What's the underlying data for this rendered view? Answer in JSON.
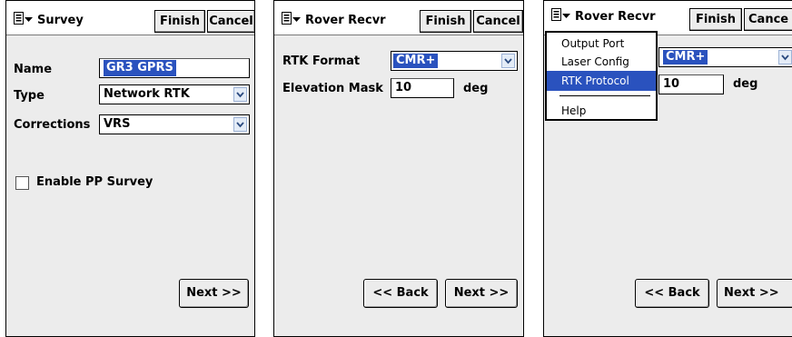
{
  "panel1": {
    "title": "Survey",
    "finish": "Finish",
    "cancel": "Cancel",
    "name_label": "Name",
    "name_value": "GR3 GPRS",
    "type_label": "Type",
    "type_value": "Network RTK",
    "corrections_label": "Corrections",
    "corrections_value": "VRS",
    "enable_pp_label": "Enable PP Survey",
    "enable_pp_checked": false,
    "next": "Next >>"
  },
  "panel2": {
    "title": "Rover Recvr",
    "finish": "Finish",
    "cancel": "Cancel",
    "rtk_format_label": "RTK Format",
    "rtk_format_value": "CMR+",
    "elevation_mask_label": "Elevation Mask",
    "elevation_mask_value": "10",
    "elevation_unit": "deg",
    "back": "<< Back",
    "next": "Next >>"
  },
  "panel3": {
    "title": "Rover Recvr",
    "finish": "Finish",
    "cancel": "Cance",
    "rtk_format_value": "CMR+",
    "elevation_mask_value": "10",
    "elevation_unit": "deg",
    "back": "<< Back",
    "next": "Next >>",
    "menu": {
      "items": [
        "Output Port",
        "Laser Config",
        "RTK Protocol",
        "Help"
      ],
      "selected": "RTK Protocol"
    }
  },
  "icons": {
    "menu": "menu-icon",
    "dropdown": "chevron-down-icon"
  },
  "colors": {
    "highlight": "#2a52be",
    "panel_bg": "#ececec"
  }
}
